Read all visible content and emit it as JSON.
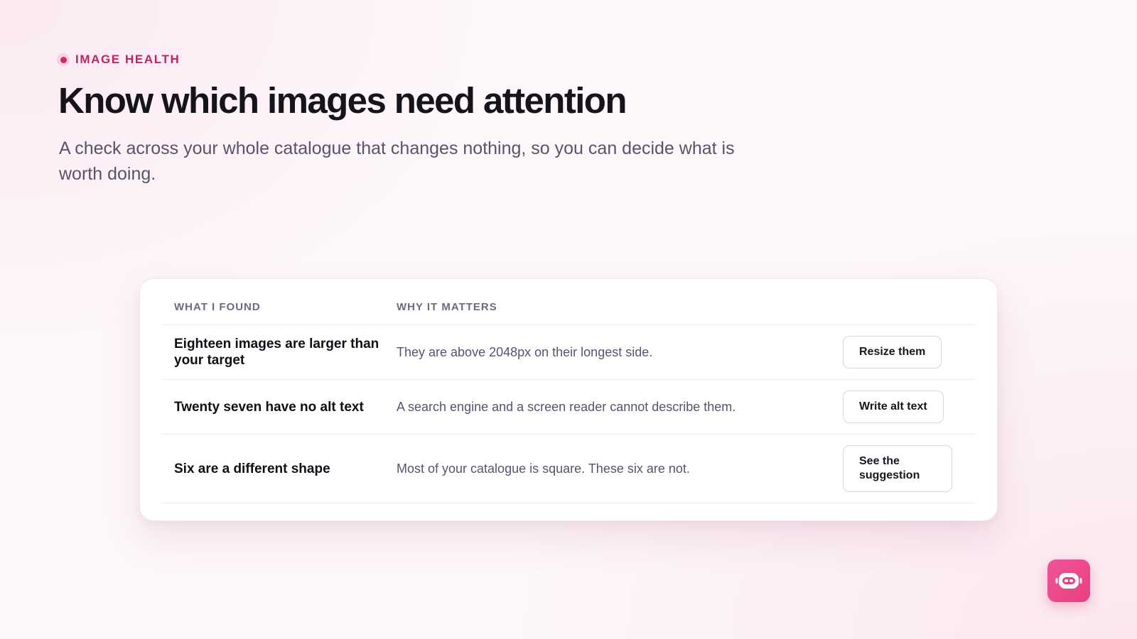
{
  "header": {
    "eyebrow": "IMAGE HEALTH",
    "title": "Know which images need attention",
    "subtitle": "A check across your whole catalogue that changes nothing, so you can decide what is worth doing."
  },
  "table": {
    "columns": [
      "WHAT I FOUND",
      "WHY IT MATTERS"
    ],
    "rows": [
      {
        "finding": "Eighteen images are larger than your target",
        "why": "They are above 2048px on their longest side.",
        "action": "Resize them"
      },
      {
        "finding": "Twenty seven have no alt text",
        "why": "A search engine and a screen reader cannot describe them.",
        "action": "Write alt text"
      },
      {
        "finding": "Six are a different shape",
        "why": "Most of your catalogue is square. These six are not.",
        "action": "See the suggestion"
      }
    ]
  },
  "assistant_button": {
    "icon": "robot-icon"
  },
  "colors": {
    "accent": "#c0235f",
    "accent_dot": "#d6286f",
    "fab": "#ee4f94"
  }
}
